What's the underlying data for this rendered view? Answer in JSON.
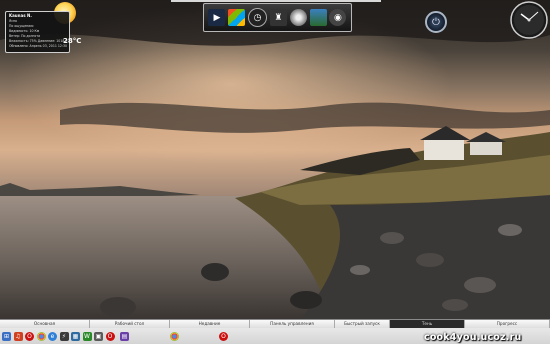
{
  "weather": {
    "city": "Kaunas N.",
    "lines": [
      "Ясно",
      "По ощущению: ",
      "Видимость: 10 Км",
      "Ветер: По долгота",
      "Влажность: 75%  Давление: 1018,0",
      "Обновлено: Апрель 03, 2011 12:30"
    ],
    "temperature": "28°C"
  },
  "dock": {
    "icons": [
      "media-player-icon",
      "windows-icon",
      "clock-icon",
      "cup-icon",
      "disc-icon",
      "photo-icon",
      "vista-icon"
    ]
  },
  "taskbar": {
    "tabs": [
      "Основная",
      "Рабочий стол",
      "Недавние",
      "Панель управления",
      "Быстрый запуск",
      "Тень",
      "Прогресс"
    ],
    "icons": [
      "windows-icon",
      "media-icon",
      "opera-icon",
      "chrome-icon",
      "ie-icon",
      "winamp-icon",
      "explorer-icon",
      "folder-icon",
      "hd-icon",
      "opera-icon",
      "flag-icon",
      "chrome-icon",
      "opera-icon"
    ]
  },
  "watermark": "cook4you.ucoz.ru",
  "colors": {
    "taskbar": "#e4e4e4",
    "accent": "#f0a020"
  }
}
